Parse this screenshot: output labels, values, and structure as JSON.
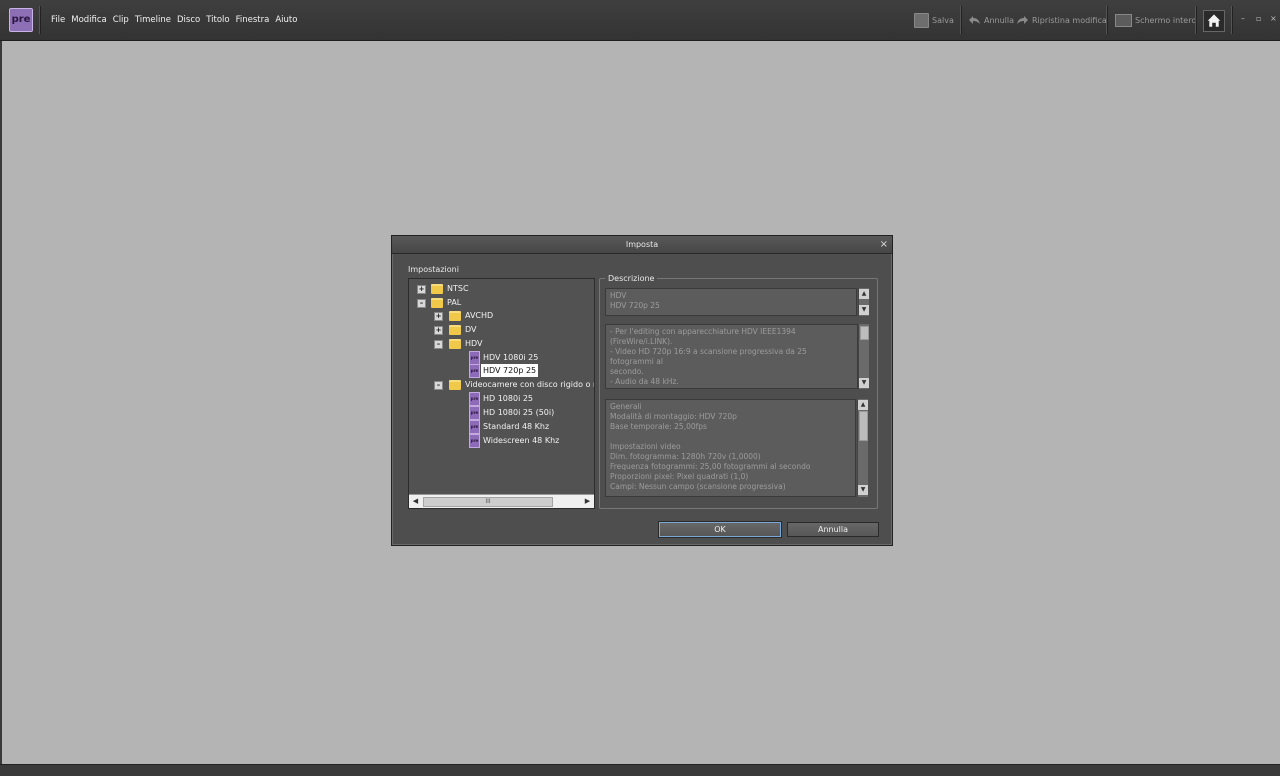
{
  "app": {
    "logo_text": "pre"
  },
  "menu": [
    "File",
    "Modifica",
    "Clip",
    "Timeline",
    "Disco",
    "Titolo",
    "Finestra",
    "Aiuto"
  ],
  "toolbar": {
    "save_label": "Salva",
    "undo_label": "Annulla",
    "redo_label": "Ripristina modifica",
    "fullscreen_label": "Schermo intero"
  },
  "window_controls": {
    "minimize": "–",
    "restore": "▫",
    "close": "×"
  },
  "dialog": {
    "title": "Imposta",
    "close": "×",
    "settings_label": "Impostazioni",
    "tree": [
      {
        "label": "NTSC",
        "expander": "+"
      },
      {
        "label": "PAL",
        "expander": "–"
      },
      {
        "label": "AVCHD",
        "expander": "+"
      },
      {
        "label": "DV",
        "expander": "+"
      },
      {
        "label": "HDV",
        "expander": "–"
      },
      {
        "label": "HDV 1080i 25"
      },
      {
        "label": "HDV 720p 25",
        "selected": true
      },
      {
        "label": "Videocamere con disco rigido o men",
        "expander": "–"
      },
      {
        "label": "HD 1080i 25"
      },
      {
        "label": "HD 1080i 25 (50i)"
      },
      {
        "label": "Standard 48 Khz"
      },
      {
        "label": "Widescreen 48 Khz"
      }
    ],
    "hscroll_grip": "III",
    "description_label": "Descrizione",
    "preset_name": [
      "HDV",
      "HDV 720p 25"
    ],
    "preset_description": [
      "- Per l'editing con apparecchiature HDV IEEE1394 (FireWire/i.LINK).",
      "- Video HD 720p 16:9 a scansione progressiva da 25 fotogrammi al",
      "secondo.",
      "- Audio da 48 kHz."
    ],
    "general_info": [
      "Generali",
      " Modalità di montaggio: HDV 720p",
      " Base temporale: 25,00fps",
      "",
      "Impostazioni video",
      " Dim. fotogramma: 1280h 720v (1,0000)",
      " Frequenza fotogrammi: 25,00 fotogrammi al secondo",
      " Proporzioni pixel: Pixel quadrati (1,0)",
      " Campi: Nessun campo (scansione progressiva)"
    ],
    "ok_label": "OK",
    "cancel_label": "Annulla"
  },
  "icons": {
    "save": "save-icon",
    "undo": "undo-arrow-icon",
    "redo": "redo-arrow-icon",
    "fullscreen": "monitor-icon",
    "home": "home-icon",
    "folder": "folder-icon",
    "preset": "preset-file-icon"
  }
}
